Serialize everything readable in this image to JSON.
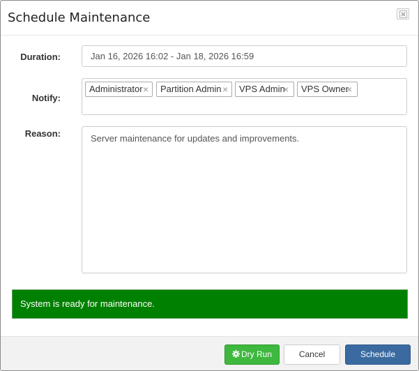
{
  "dialog": {
    "title": "Schedule Maintenance",
    "close_icon": "close-icon"
  },
  "form": {
    "duration": {
      "label": "Duration:",
      "value": "Jan 16, 2026 16:02 - Jan 18, 2026 16:59"
    },
    "notify": {
      "label": "Notify:",
      "chips": [
        {
          "label": "Administrator",
          "remove": "×"
        },
        {
          "label": "Partition Admin",
          "remove": "×"
        },
        {
          "label": "VPS Admin",
          "remove": "×"
        },
        {
          "label": "VPS Owner",
          "remove": "×"
        }
      ]
    },
    "reason": {
      "label": "Reason:",
      "value": "Server maintenance for updates and improvements."
    }
  },
  "status": {
    "message": "System is ready for maintenance.",
    "color": "#008000"
  },
  "footer": {
    "dry_run_label": "Dry Run",
    "dry_run_icon": "gear-icon",
    "cancel_label": "Cancel",
    "schedule_label": "Schedule"
  },
  "colors": {
    "dry_run": "#3eb83e",
    "schedule": "#3a6aa0",
    "status": "#008000"
  }
}
